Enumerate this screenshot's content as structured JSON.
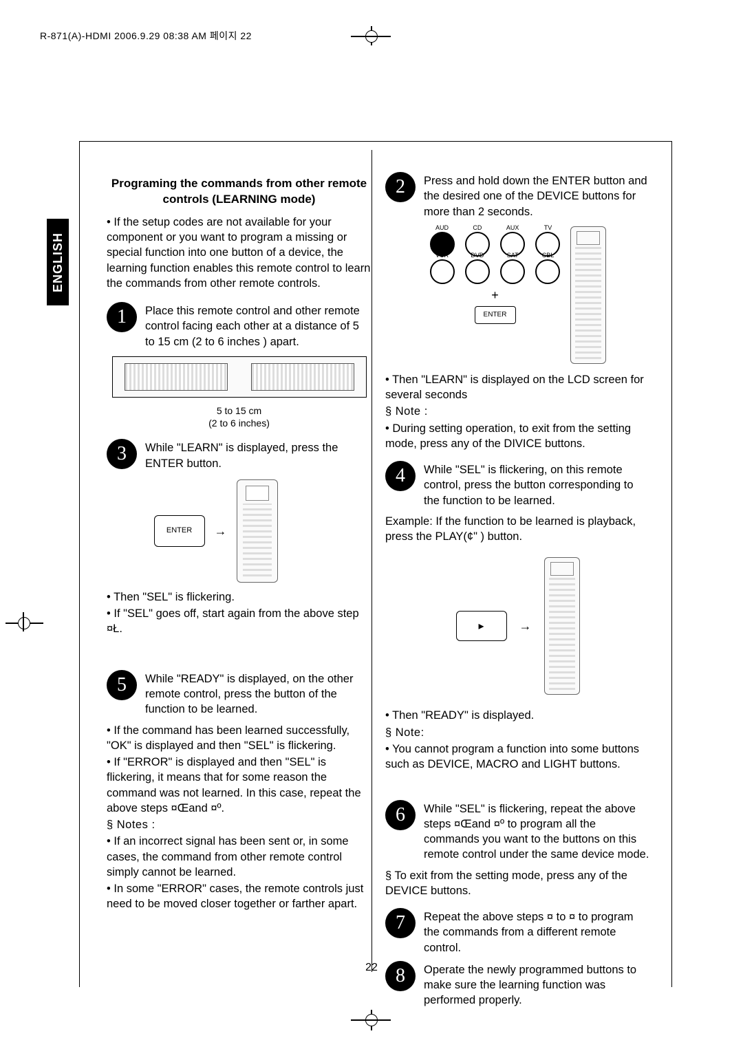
{
  "header_text": "R-871(A)-HDMI  2006.9.29  08:38 AM 페이지 22",
  "language_tab": "ENGLISH",
  "page_number": "22",
  "section_title": "Programing the commands from other remote controls (LEARNING mode)",
  "intro": "• If the setup codes are not available for your component or you want to program a missing or special function into one button of a device, the learning function enables this remote control to learn the commands from other remote controls.",
  "step1": {
    "num": "1",
    "text": "Place this remote control and other remote control facing each other at a distance of 5 to 15 cm (2 to 6 inches ) apart."
  },
  "fig1_caption_line1": "5 to 15 cm",
  "fig1_caption_line2": "(2 to 6 inches)",
  "step2": {
    "num": "2",
    "text": "Press and hold down the ENTER button and the desired one of the DEVICE buttons for more than 2 seconds."
  },
  "device_labels": {
    "r1": [
      "AUD",
      "CD",
      "AUX",
      "TV"
    ],
    "r2": [
      "VCR",
      "DVD",
      "SAT",
      "CBL"
    ]
  },
  "enter_label": "ENTER",
  "step2_bullets": [
    "• Then \"LEARN\" is displayed on the LCD screen for several seconds",
    "§ Note :",
    "• During setting operation, to exit from the setting mode, press any of the DIVICE buttons."
  ],
  "step3": {
    "num": "3",
    "text": "While \"LEARN\" is displayed, press the ENTER button."
  },
  "step3_bullets": [
    "• Then \"SEL\" is flickering.",
    "• If \"SEL\" goes off, start again from the above step ¤Ł."
  ],
  "step4": {
    "num": "4",
    "text": "While \"SEL\" is flickering, on this remote control, press the button corresponding to the function to be learned."
  },
  "step4_example": "Example: If the function to be learned is playback, press the PLAY(¢\" ) button.",
  "step4_bullets": [
    "• Then \"READY\" is displayed.",
    "§ Note:",
    "• You cannot program a function into some buttons such as DEVICE, MACRO and LIGHT buttons."
  ],
  "step5": {
    "num": "5",
    "text": "While  \"READY\" is displayed, on the other remote control, press the button of the function to be learned."
  },
  "step5_bullets": [
    "• If the command has been learned successfully, \"OK\" is displayed and then \"SEL\" is flickering.",
    "• If \"ERROR\" is displayed and then \"SEL\" is flickering, it means that for some reason the command was not learned. In this case, repeat the above steps ¤Œand ¤º.",
    "§ Notes :",
    "• If an incorrect signal has been sent or, in some cases, the command from other remote control simply cannot be learned.",
    "• In some \"ERROR\" cases, the remote controls just need to be moved closer together or farther apart."
  ],
  "step6": {
    "num": "6",
    "text": "While \"SEL\" is flickering, repeat the above steps ¤Œand ¤º to program all the commands you want to the buttons on this remote control under the same device mode."
  },
  "step6_bullets": [
    "§ To exit from the setting mode, press any of the DEVICE buttons."
  ],
  "step7": {
    "num": "7",
    "text": "Repeat the above steps ¤  to ¤  to program the commands from a different remote control."
  },
  "step8": {
    "num": "8",
    "text": "Operate the newly programmed buttons to make sure the learning function was performed properly."
  }
}
